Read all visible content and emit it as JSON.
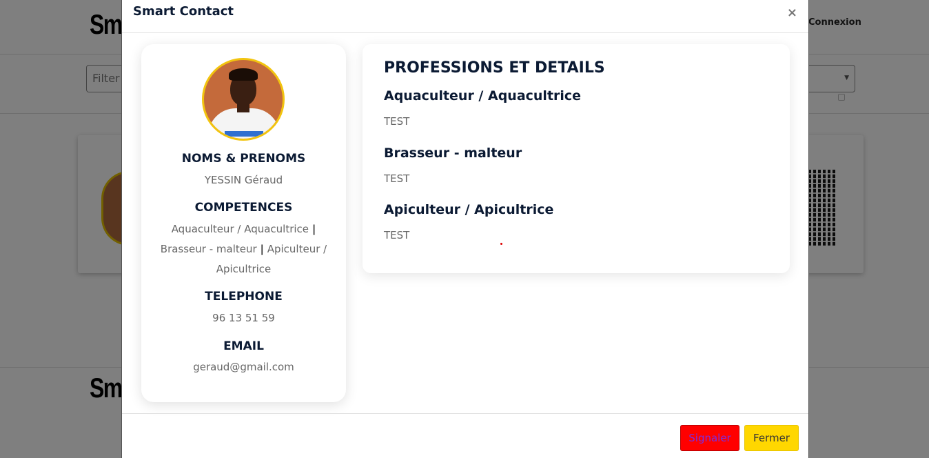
{
  "background": {
    "logo_text": "Sma",
    "login_link": "Connexion",
    "filter_placeholder": "Filter",
    "footer_logo_text": "Sma"
  },
  "modal": {
    "title": "Smart Contact",
    "close_symbol": "×",
    "profile": {
      "name_label": "NOMS & PRENOMS",
      "name_value": "YESSIN Géraud",
      "skills_label": "COMPETENCES",
      "skills": [
        "Aquaculteur / Aquacultrice",
        "Brasseur - malteur",
        "Apiculteur / Apicultrice"
      ],
      "skills_separator": "|",
      "phone_label": "TELEPHONE",
      "phone_value": "96 13 51 59",
      "email_label": "EMAIL",
      "email_value": "geraud@gmail.com"
    },
    "details": {
      "title": "PROFESSIONS ET DETAILS",
      "professions": [
        {
          "name": "Aquaculteur / Aquacultrice",
          "description": "TEST"
        },
        {
          "name": "Brasseur - malteur",
          "description": "TEST"
        },
        {
          "name": "Apiculteur / Apicultrice",
          "description": "TEST"
        }
      ]
    },
    "footer": {
      "report_label": "Signaler",
      "close_label": "Fermer"
    }
  },
  "colors": {
    "accent_yellow": "#ffd700",
    "report_red": "#ff0000",
    "heading_navy": "#0b1a33"
  }
}
